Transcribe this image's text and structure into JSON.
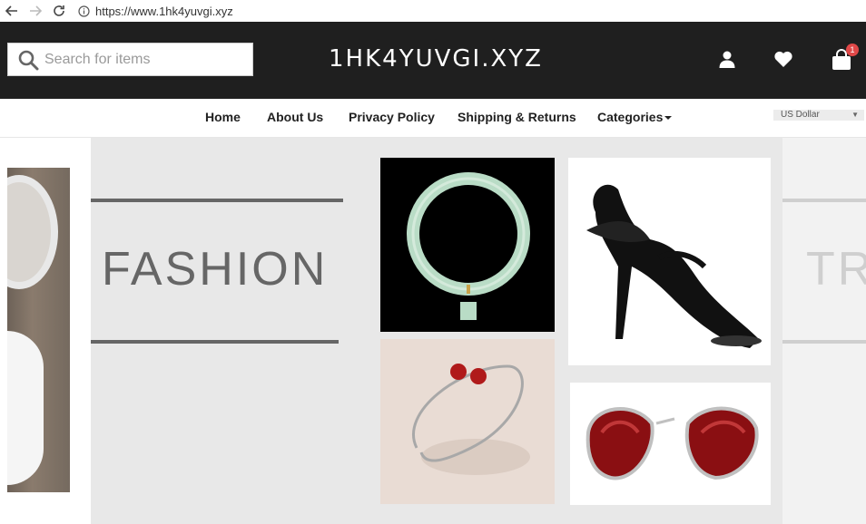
{
  "browser": {
    "url": "https://www.1hk4yuvgi.xyz"
  },
  "header": {
    "search_placeholder": "Search for items",
    "logo": "1HK4YUVGI.XYZ",
    "cart_count": "1"
  },
  "nav": {
    "items": [
      {
        "label": "Home"
      },
      {
        "label": "About Us"
      },
      {
        "label": "Privacy Policy"
      },
      {
        "label": "Shipping & Returns"
      },
      {
        "label": "Categories"
      }
    ],
    "currency": "US Dollar"
  },
  "hero": {
    "slide_title": "FASHION",
    "next_slide_partial": "TR"
  },
  "colors": {
    "header_bg": "#1f1f1f",
    "badge": "#e04848",
    "hero_bg": "#e8e8e8",
    "text_gray": "#666666"
  }
}
